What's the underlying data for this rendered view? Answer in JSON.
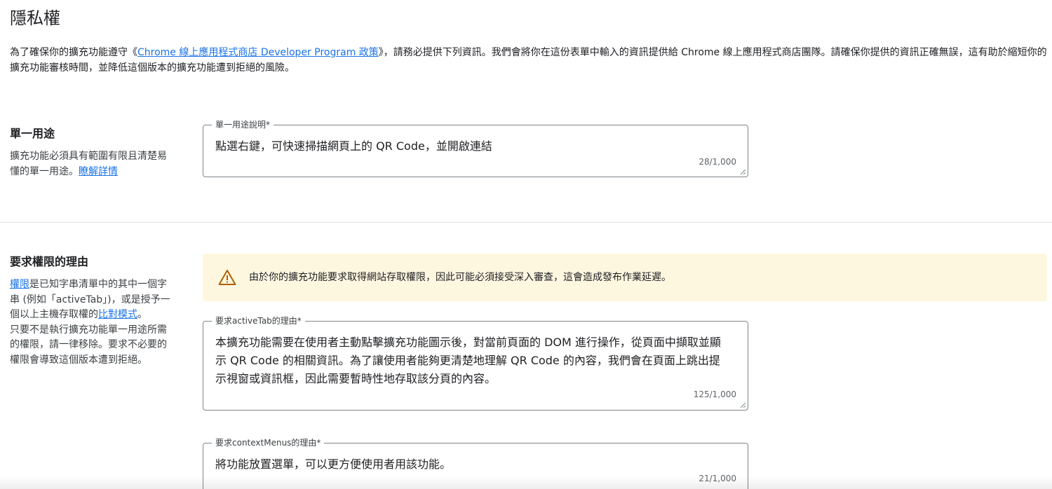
{
  "page": {
    "title": "隱私權",
    "intro": {
      "before": "為了確保你的擴充功能遵守《",
      "link": "Chrome 線上應用程式商店 Developer Program 政策",
      "after": "》，請務必提供下列資訊。我們會將你在這份表單中輸入的資訊提供給 Chrome 線上應用程式商店團隊。請確保你提供的資訊正確無誤，這有助於縮短你的擴充功能審核時間，並降低這個版本的擴充功能遭到拒絕的風險。"
    }
  },
  "single_purpose": {
    "title": "單一用途",
    "desc_before": "擴充功能必須具有範圍有限且清楚易懂的單一用途。",
    "learn_more": "瞭解詳情",
    "field": {
      "label": "單一用途說明*",
      "value": "點選右鍵，可快速掃描網頁上的 QR Code，並開啟連結",
      "count": "28/1,000"
    }
  },
  "permissions": {
    "title": "要求權限的理由",
    "desc_link1": "權限",
    "desc_part1": "是已知字串清單中的其中一個字串 (例如「activeTab」)，或是授予一個以上主機存取權的",
    "desc_link2": "比對模式",
    "desc_part2": "。",
    "desc_part3": "只要不是執行擴充功能單一用途所需的權限，請一律移除。要求不必要的權限會導致這個版本遭到拒絕。",
    "warning": "由於你的擴充功能要求取得網站存取權限，因此可能必須接受深入審查，這會造成發布作業延遲。",
    "activetab": {
      "label": "要求activeTab的理由*",
      "value": "本擴充功能需要在使用者主動點擊擴充功能圖示後，對當前頁面的 DOM 進行操作，從頁面中擷取並顯示 QR Code 的相關資訊。為了讓使用者能夠更清楚地理解 QR Code 的內容，我們會在頁面上跳出提示視窗或資訊框，因此需要暫時性地存取該分頁的內容。",
      "count": "125/1,000"
    },
    "contextmenus": {
      "label": "要求contextMenus的理由*",
      "value": "將功能放置選單，可以更方便使用者用該功能。",
      "count": "21/1,000"
    }
  },
  "colors": {
    "link": "#1a73e8",
    "warning_bg": "#fef7e0",
    "warning_icon": "#b06000",
    "field_border": "#80868b"
  },
  "icons": {
    "warning": "warning-triangle-icon",
    "resize": "resize-handle-icon"
  }
}
